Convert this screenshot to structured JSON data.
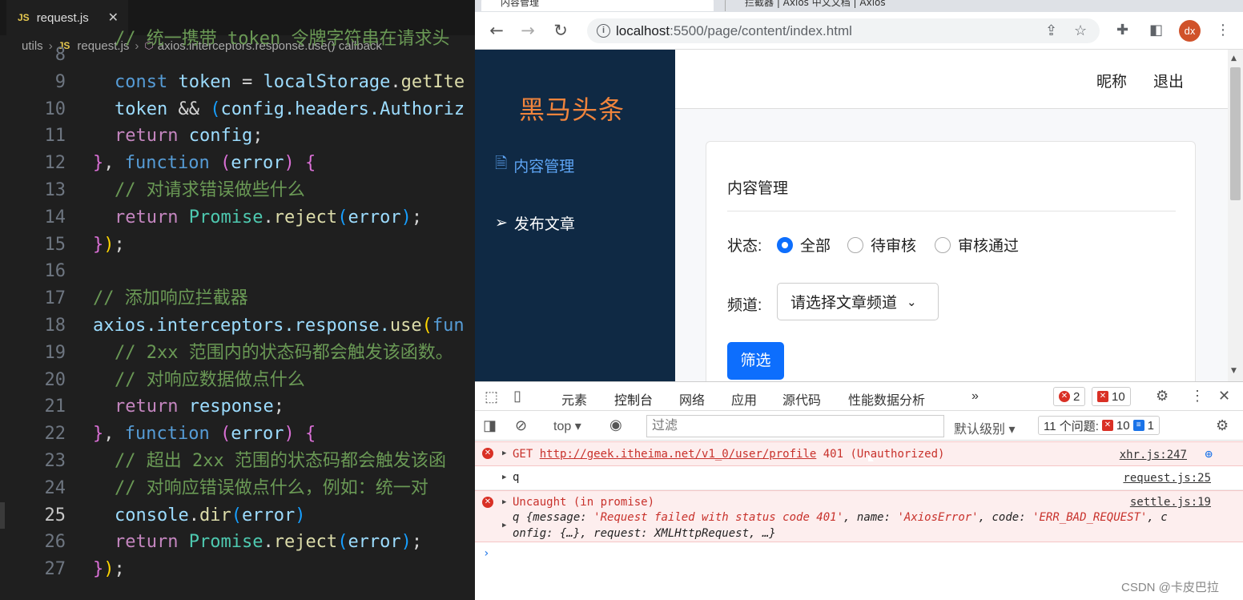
{
  "editor": {
    "tab": {
      "badge": "JS",
      "name": "request.js",
      "close": "✕"
    },
    "breadcrumb": {
      "folder": "utils",
      "badge": "JS",
      "file": "request.js",
      "symbol": "axios.interceptors.response.use() callback"
    },
    "active_line": "25",
    "lines": [
      "8",
      "9",
      "10",
      "11",
      "12",
      "13",
      "14",
      "15",
      "16",
      "17",
      "18",
      "19",
      "20",
      "21",
      "22",
      "23",
      "24",
      "25",
      "26",
      "27"
    ],
    "code": {
      "l8": "// 统一携带 token 令牌字符串在请求头",
      "l9_kw": "const",
      "l9_var": "token",
      "l9_eq": " = ",
      "l9_obj": "localStorage",
      "l9_dot": ".",
      "l9_fn": "getIte",
      "l10_var": "token",
      "l10_op": " && ",
      "l10_paren": "(",
      "l10_rest": "config.headers.Authoriz",
      "l11_kw": "return",
      "l11_var": "config",
      "l11_semi": ";",
      "l12_brace": "}",
      "l12_comma": ", ",
      "l12_kw": "function",
      "l12_sp": " ",
      "l12_p1": "(",
      "l12_var": "error",
      "l12_p2": ")",
      "l12_sp2": " ",
      "l12_b": "{",
      "l13": "// 对请求错误做些什么",
      "l14_kw": "return",
      "l14_cls": "Promise",
      "l14_dot": ".",
      "l14_fn": "reject",
      "l14_p1": "(",
      "l14_var": "error",
      "l14_p2": ")",
      "l14_semi": ";",
      "l15_brace": "}",
      "l15_p": ")",
      "l15_semi": ";",
      "l17": "// 添加响应拦截器",
      "l18_obj": "axios",
      "l18_rest": ".interceptors.response.",
      "l18_fn": "use",
      "l18_p": "(",
      "l18_kw": "fun",
      "l19": "// 2xx 范围内的状态码都会触发该函数。",
      "l20": "// 对响应数据做点什么",
      "l21_kw": "return",
      "l21_var": "response",
      "l21_semi": ";",
      "l22_brace": "}",
      "l22_comma": ", ",
      "l22_kw": "function",
      "l22_sp": " ",
      "l22_p1": "(",
      "l22_var": "error",
      "l22_p2": ")",
      "l22_sp2": " ",
      "l22_b": "{",
      "l23": "// 超出 2xx 范围的状态码都会触发该函",
      "l24": "// 对响应错误做点什么，例如：统一对",
      "l25_var": "console",
      "l25_dot": ".",
      "l25_fn": "dir",
      "l25_p1": "(",
      "l25_arg": "error",
      "l25_p2": ")",
      "l26_kw": "return",
      "l26_cls": "Promise",
      "l26_dot": ".",
      "l26_fn": "reject",
      "l26_p1": "(",
      "l26_var": "error",
      "l26_p2": ")",
      "l26_semi": ";",
      "l27_brace": "}",
      "l27_p": ")",
      "l27_semi": ";"
    }
  },
  "browser": {
    "tabs": [
      "内容管理",
      "拦截器 | Axios 中文文档 | Axios"
    ],
    "url_host": "localhost",
    "url_rest": ":5500/page/content/index.html",
    "avatar": "dx",
    "app": {
      "logo": "黑马头条",
      "sidebar": [
        {
          "label": "内容管理"
        },
        {
          "label": "发布文章"
        }
      ],
      "topnav": {
        "nickname": "昵称",
        "logout": "退出"
      },
      "card_title": "内容管理",
      "status_label": "状态:",
      "status_options": [
        "全部",
        "待审核",
        "审核通过"
      ],
      "status_selected": "全部",
      "channel_label": "频道:",
      "channel_select": "请选择文章频道",
      "filter_button": "筛选"
    }
  },
  "devtools": {
    "tabs": [
      "元素",
      "控制台",
      "网络",
      "应用",
      "源代码",
      "性能数据分析"
    ],
    "active_tab": "控制台",
    "more": "»",
    "error_count": "2",
    "warning_count": "10",
    "context": "top",
    "filter_placeholder": "过滤",
    "levels": "默认级别",
    "issues_label": "11 个问题:",
    "issues_errors": "10",
    "issues_info": "1",
    "console": {
      "row1": {
        "method": "GET",
        "url": "http://geek.itheima.net/v1_0/user/profile",
        "status": "401 (Unauthorized)",
        "source": "xhr.js:247"
      },
      "row2": {
        "text": "q",
        "source": "request.js:25"
      },
      "row3": {
        "title": "Uncaught (in promise)",
        "source": "settle.js:19",
        "p1": "q {message: ",
        "s1": "'Request failed with status code 401'",
        "p2": ", name: ",
        "s2": "'AxiosError'",
        "p3": ", code: ",
        "s3": "'ERR_BAD_REQUEST'",
        "p4": ", c",
        "line2": "onfig: {…}, request: XMLHttpRequest, …}"
      },
      "prompt": "›"
    }
  },
  "watermark": "CSDN @卡皮巴拉",
  "icons": [
    "search-icon",
    "bookmark-star-icon",
    "share-icon",
    "extensions-icon",
    "sidepanel-icon",
    "back-icon",
    "forward-icon",
    "reload-icon",
    "lock-icon",
    "document-icon",
    "send-icon",
    "chevron-down-icon",
    "inspect-icon",
    "device-icon",
    "settings-icon",
    "more-icon",
    "close-icon",
    "sidebar-toggle-icon",
    "clear-console-icon",
    "eye-icon"
  ],
  "colors": {
    "sidebar_bg": "#0f2944",
    "logo": "#f0843c",
    "primary": "#0d6efd",
    "error": "#d93025"
  }
}
